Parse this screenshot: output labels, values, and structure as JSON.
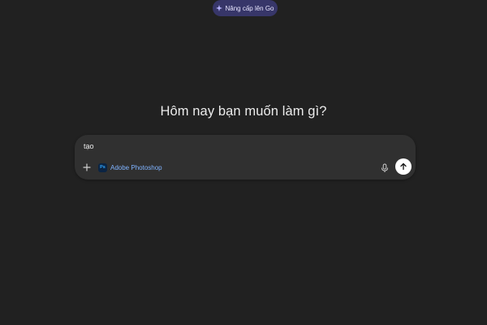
{
  "header": {
    "upgrade_label": "Nâng cấp lên Go",
    "upgrade_icon": "sparkle-icon"
  },
  "main": {
    "heading": "Hôm nay bạn muốn làm gì?"
  },
  "composer": {
    "input_value": "tạo",
    "tool_chip": {
      "icon_text": "Ps",
      "label": "Adobe Photoshop"
    },
    "icons": [
      "plus-icon",
      "microphone-icon",
      "arrow-up-icon"
    ]
  },
  "colors": {
    "background": "#212121",
    "composer": "#303030",
    "upgrade_pill": "#373669",
    "tool_label": "#7fb3ff",
    "send_button": "#ffffff"
  }
}
